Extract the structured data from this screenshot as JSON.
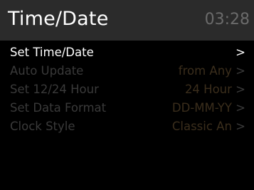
{
  "header": {
    "title": "Time/Date",
    "clock": "03:28"
  },
  "menu": {
    "items": [
      {
        "label": "Set Time/Date",
        "value": "",
        "arrow": ">"
      },
      {
        "label": "Auto Update",
        "value": "from Any",
        "arrow": ">"
      },
      {
        "label": "Set 12/24 Hour",
        "value": "24 Hour",
        "arrow": ">"
      },
      {
        "label": "Set Data Format",
        "value": "DD-MM-YY",
        "arrow": ">"
      },
      {
        "label": "Clock Style",
        "value": "Classic An",
        "arrow": ">"
      }
    ],
    "selected_index": 0
  },
  "colors": {
    "background": "#000000",
    "header_bg": "#2b2b2b",
    "selected_text": "#ffffff",
    "dim_label": "#3a3a3a",
    "dim_value": "#3b2e1c",
    "clock_text": "#6b6b6b"
  }
}
